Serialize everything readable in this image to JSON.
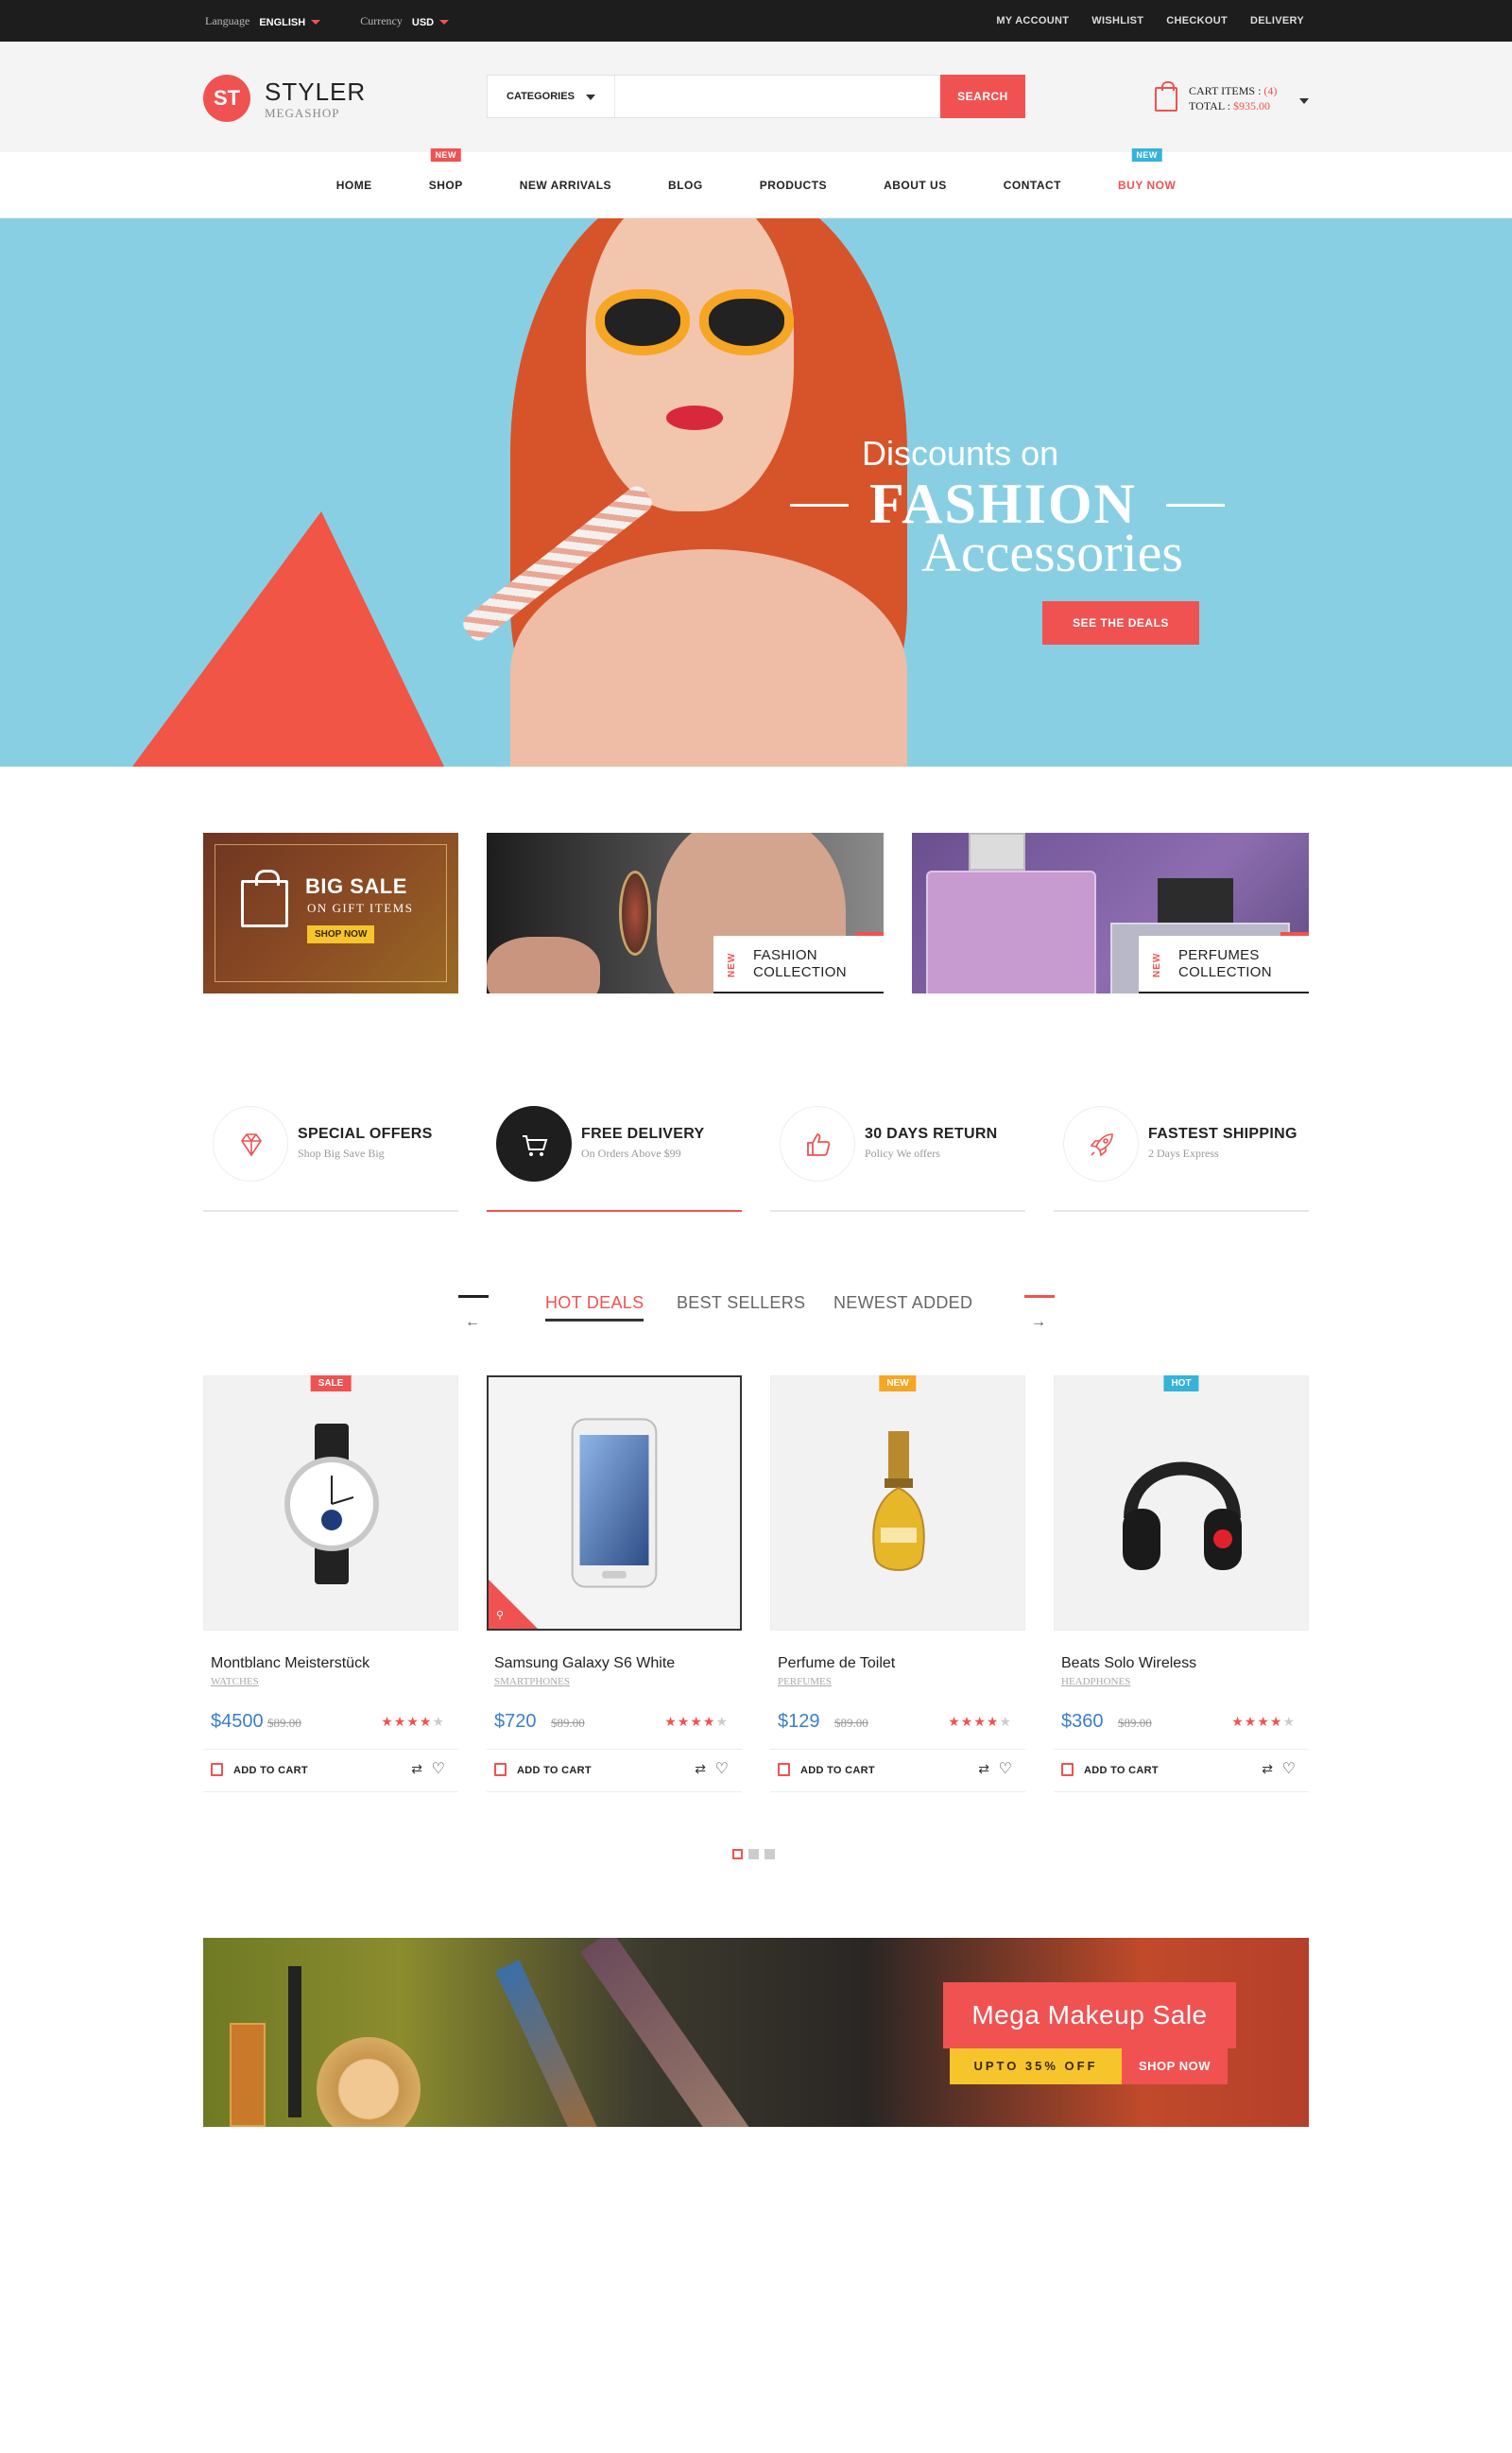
{
  "topbar": {
    "language_label": "Language",
    "language_value": "ENGLISH",
    "currency_label": "Currency",
    "currency_value": "USD",
    "links": [
      "MY ACCOUNT",
      "WISHLIST",
      "CHECKOUT",
      "DELIVERY"
    ]
  },
  "header": {
    "logo_mark": "ST",
    "logo_name": "STYLER",
    "logo_sub": "MEGASHOP",
    "search_category": "CATEGORIES",
    "search_value": "",
    "search_button": "SEARCH",
    "cart_items_label": "CART ITEMS : ",
    "cart_items_count": "(4)",
    "cart_total_label": "TOTAL : ",
    "cart_total_value": "$935.00"
  },
  "nav": {
    "items": [
      {
        "label": "HOME",
        "badge": ""
      },
      {
        "label": "SHOP",
        "badge": "NEW"
      },
      {
        "label": "NEW ARRIVALS",
        "badge": ""
      },
      {
        "label": "BLOG",
        "badge": ""
      },
      {
        "label": "PRODUCTS",
        "badge": ""
      },
      {
        "label": "ABOUT US",
        "badge": ""
      },
      {
        "label": "CONTACT",
        "badge": ""
      },
      {
        "label": "BUY NOW",
        "badge": "NEW"
      }
    ]
  },
  "hero": {
    "line1": "Discounts on",
    "line2": "FASHION",
    "line3": "Accessories",
    "cta": "SEE THE DEALS"
  },
  "banners": {
    "big_sale": {
      "title": "BIG SALE",
      "subtitle": "ON GIFT ITEMS",
      "cta": "SHOP NOW"
    },
    "fashion": {
      "tag": "NEW",
      "line1": "FASHION",
      "line2": "COLLECTION"
    },
    "perfumes": {
      "tag": "NEW",
      "line1": "PERFUMES",
      "line2": "COLLECTION"
    }
  },
  "features": [
    {
      "title": "SPECIAL OFFERS",
      "sub": "Shop Big Save Big",
      "icon": "diamond-icon"
    },
    {
      "title": "FREE DELIVERY",
      "sub": "On Orders Above $99",
      "icon": "cart-icon"
    },
    {
      "title": "30 DAYS RETURN",
      "sub": "Policy We offers",
      "icon": "thumbs-up-icon"
    },
    {
      "title": "FASTEST SHIPPING",
      "sub": "2 Days Express",
      "icon": "rocket-icon"
    }
  ],
  "tabs": [
    "HOT DEALS",
    "BEST SELLERS",
    "NEWEST ADDED"
  ],
  "products": [
    {
      "name": "Montblanc Meisterstück",
      "category": "WATCHES",
      "price": "$4500",
      "old_price": "$89.00",
      "tag": "SALE",
      "rating": 4,
      "action": "ADD TO CART"
    },
    {
      "name": "Samsung Galaxy S6 White",
      "category": "SMARTPHONES",
      "price": "$720",
      "old_price": "$89.00",
      "tag": "",
      "rating": 4,
      "action": "ADD TO CART"
    },
    {
      "name": "Perfume de Toilet",
      "category": "PERFUMES",
      "price": "$129",
      "old_price": "$89.00",
      "tag": "NEW",
      "rating": 4,
      "action": "ADD TO CART"
    },
    {
      "name": "Beats Solo Wireless",
      "category": "HEADPHONES",
      "price": "$360",
      "old_price": "$89.00",
      "tag": "HOT",
      "rating": 4,
      "action": "ADD TO CART"
    }
  ],
  "makeup": {
    "title": "Mega Makeup Sale",
    "offer": "UPTO 35% OFF",
    "cta": "SHOP NOW"
  },
  "colors": {
    "accent": "#f05252",
    "blue": "#36b3d9",
    "yellow": "#f6c52c",
    "price": "#3b7fc9"
  }
}
